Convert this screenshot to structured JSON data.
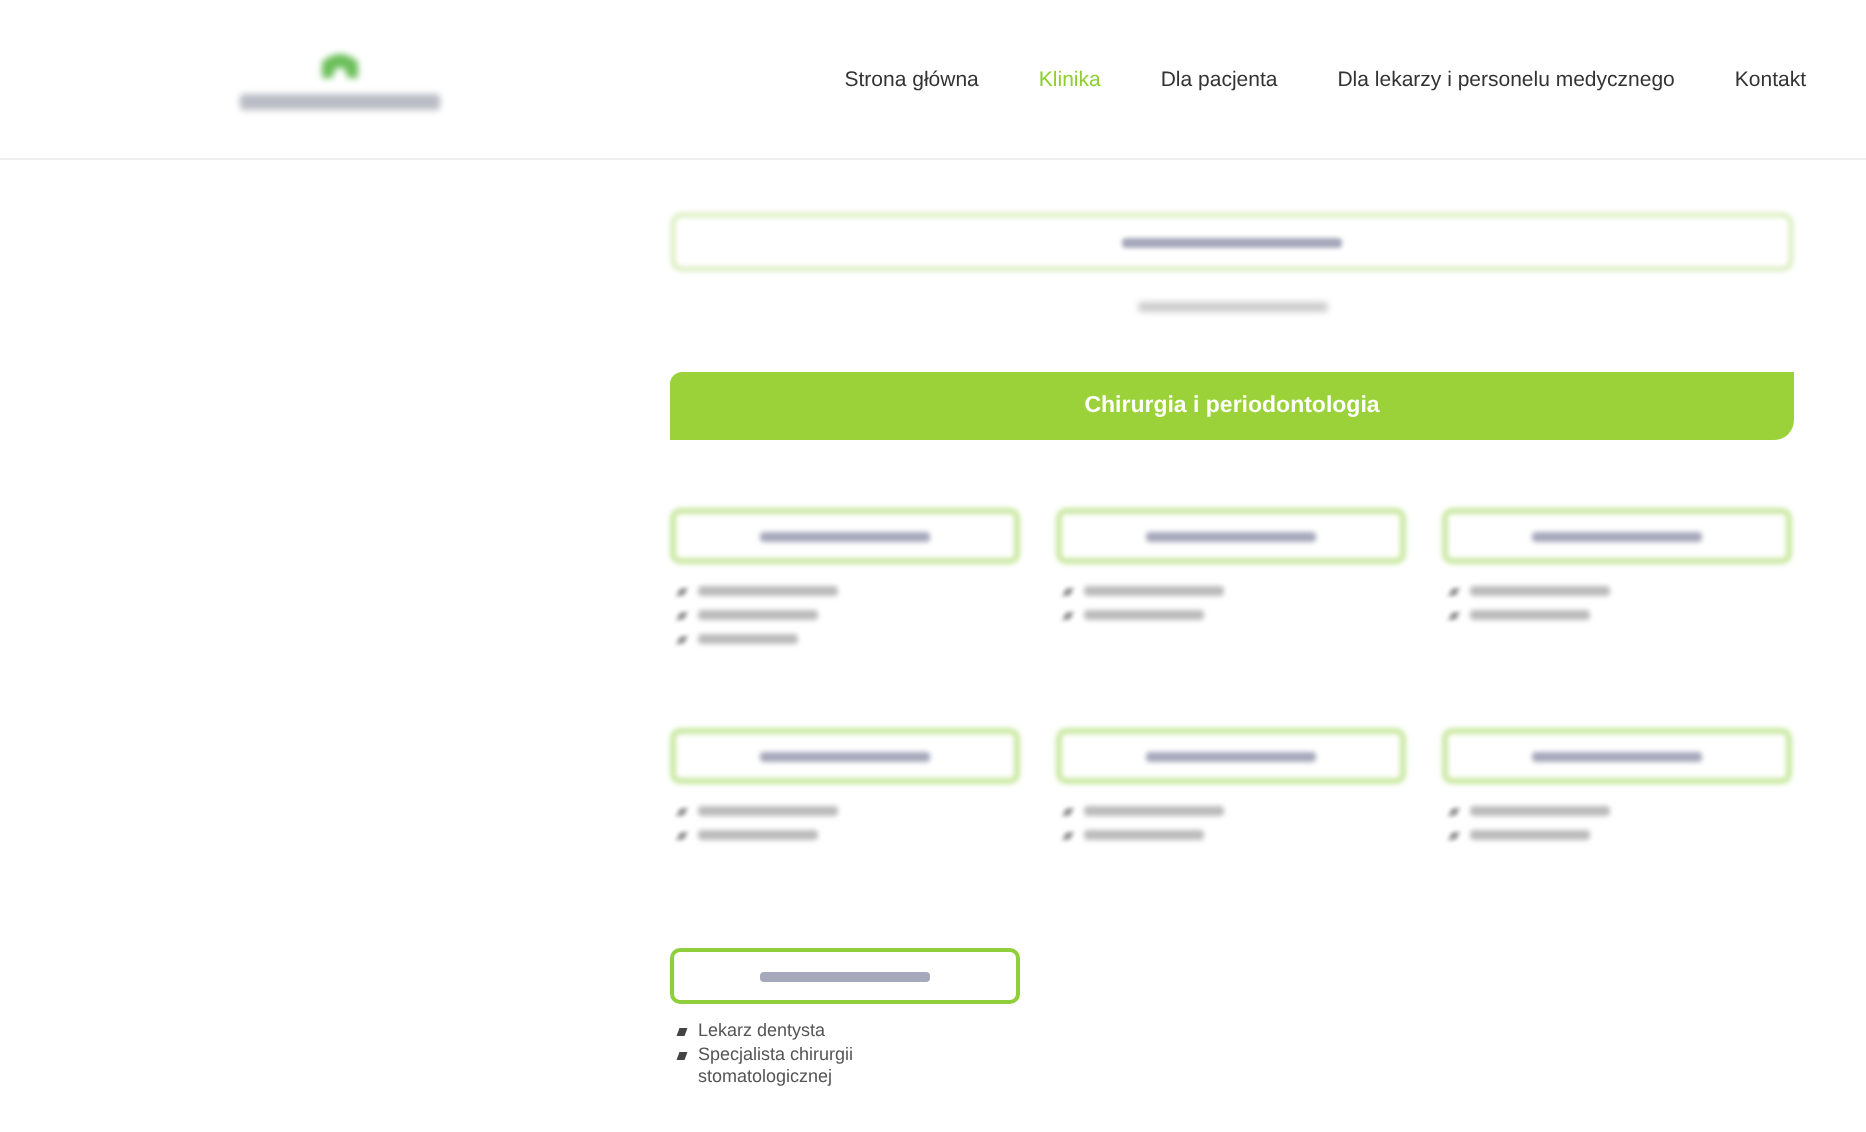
{
  "header": {
    "logo": {
      "kind": "redacted"
    },
    "nav": [
      {
        "label": "Strona główna",
        "selected": false
      },
      {
        "label": "Klinika",
        "selected": true
      },
      {
        "label": "Dla pacjenta",
        "selected": false
      },
      {
        "label": "Dla lekarzy i personelu medycznego",
        "selected": false
      },
      {
        "label": "Kontakt",
        "selected": false
      }
    ]
  },
  "featured": {
    "kind": "redacted"
  },
  "section": {
    "title": "Chirurgia i periodontologia"
  },
  "doctors": [
    {
      "kind": "redacted",
      "items": [
        {
          "kind": "redacted"
        },
        {
          "kind": "redacted"
        },
        {
          "kind": "redacted"
        }
      ]
    },
    {
      "kind": "redacted",
      "items": [
        {
          "kind": "redacted"
        },
        {
          "kind": "redacted"
        }
      ]
    },
    {
      "kind": "redacted",
      "items": [
        {
          "kind": "redacted"
        },
        {
          "kind": "redacted"
        }
      ]
    },
    {
      "kind": "redacted",
      "items": [
        {
          "kind": "redacted"
        },
        {
          "kind": "redacted"
        }
      ]
    },
    {
      "kind": "redacted",
      "items": [
        {
          "kind": "redacted"
        },
        {
          "kind": "redacted"
        }
      ]
    },
    {
      "kind": "redacted",
      "items": [
        {
          "kind": "redacted"
        },
        {
          "kind": "redacted"
        }
      ]
    },
    {
      "kind": "partial",
      "items": [
        {
          "kind": "text",
          "text": "Lekarz dentysta"
        },
        {
          "kind": "text",
          "text": "Specjalista chirurgii stomatologicznej"
        }
      ]
    }
  ]
}
